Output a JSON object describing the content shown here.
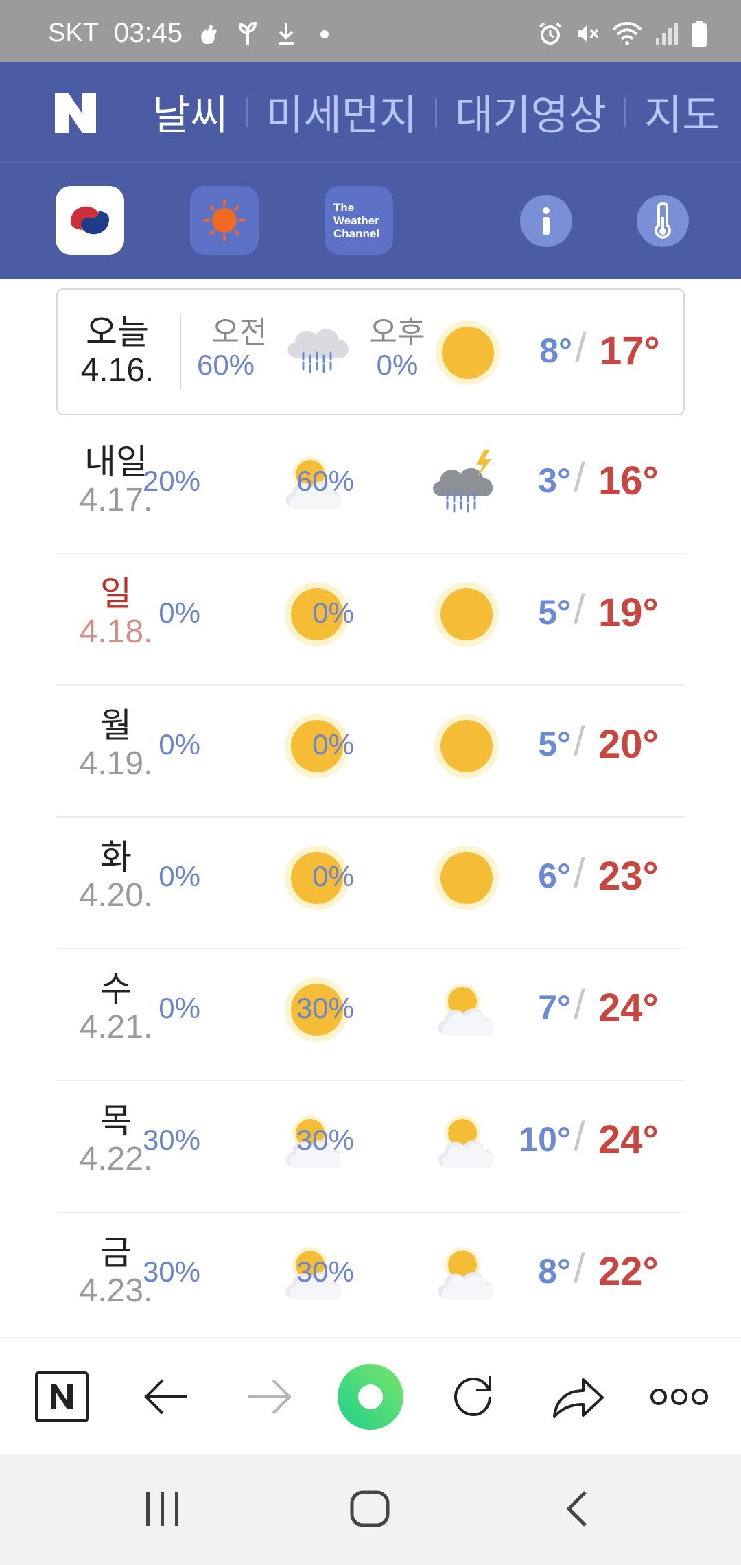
{
  "status_bar": {
    "carrier": "SKT",
    "time": "03:45",
    "left_icons": [
      "hand-icon",
      "sprout-icon",
      "download-icon",
      "dot-icon"
    ],
    "right_icons": [
      "alarm-icon",
      "mute-icon",
      "wifi-icon",
      "signal-icon",
      "battery-icon"
    ]
  },
  "nav": {
    "logo": "N",
    "tabs": [
      {
        "label": "날씨",
        "active": true
      },
      {
        "label": "미세먼지",
        "active": false
      },
      {
        "label": "대기영상",
        "active": false
      },
      {
        "label": "지도",
        "active": false
      }
    ]
  },
  "providers": {
    "items": [
      {
        "name": "korea-meteorological-icon",
        "selected": true
      },
      {
        "name": "sun-provider-icon",
        "selected": false
      },
      {
        "name": "the-weather-channel-logo",
        "selected": false,
        "text": "The Weather Channel"
      }
    ],
    "info_icon": "info-icon",
    "thermometer_icon": "thermometer-icon"
  },
  "forecast": {
    "am_label": "오전",
    "pm_label": "오후",
    "days": [
      {
        "name": "오늘",
        "date": "4.16.",
        "am_pct": "60%",
        "am_icon": "rain",
        "pm_pct": "0%",
        "pm_icon": "sunny",
        "low": "8°",
        "high": "17°",
        "today": true,
        "sunday": false
      },
      {
        "name": "내일",
        "date": "4.17.",
        "am_pct": "20%",
        "am_icon": "partly-cloudy",
        "pm_pct": "60%",
        "pm_icon": "thunder-rain",
        "low": "3°",
        "high": "16°",
        "today": false,
        "sunday": false
      },
      {
        "name": "일",
        "date": "4.18.",
        "am_pct": "0%",
        "am_icon": "sunny",
        "pm_pct": "0%",
        "pm_icon": "sunny",
        "low": "5°",
        "high": "19°",
        "today": false,
        "sunday": true
      },
      {
        "name": "월",
        "date": "4.19.",
        "am_pct": "0%",
        "am_icon": "sunny",
        "pm_pct": "0%",
        "pm_icon": "sunny",
        "low": "5°",
        "high": "20°",
        "today": false,
        "sunday": false
      },
      {
        "name": "화",
        "date": "4.20.",
        "am_pct": "0%",
        "am_icon": "sunny",
        "pm_pct": "0%",
        "pm_icon": "sunny",
        "low": "6°",
        "high": "23°",
        "today": false,
        "sunday": false
      },
      {
        "name": "수",
        "date": "4.21.",
        "am_pct": "0%",
        "am_icon": "sunny",
        "pm_pct": "30%",
        "pm_icon": "partly-cloudy",
        "low": "7°",
        "high": "24°",
        "today": false,
        "sunday": false
      },
      {
        "name": "목",
        "date": "4.22.",
        "am_pct": "30%",
        "am_icon": "partly-cloudy",
        "pm_pct": "30%",
        "pm_icon": "partly-cloudy",
        "low": "10°",
        "high": "24°",
        "today": false,
        "sunday": false
      },
      {
        "name": "금",
        "date": "4.23.",
        "am_pct": "30%",
        "am_icon": "partly-cloudy",
        "pm_pct": "30%",
        "pm_icon": "partly-cloudy",
        "low": "8°",
        "high": "22°",
        "today": false,
        "sunday": false
      }
    ],
    "slash": "/"
  },
  "browser_bar": {
    "items": [
      "naver-home-icon",
      "back-arrow-icon",
      "forward-arrow-icon",
      "green-dot-icon",
      "refresh-icon",
      "share-icon",
      "more-icon"
    ]
  },
  "android_nav": {
    "items": [
      "recents-icon",
      "home-icon",
      "back-icon"
    ]
  },
  "colors": {
    "nav_bg": "#4b5ca4",
    "accent_blue": "#6a84cf",
    "high_temp": "#c9453f",
    "sunday_red": "#b8322a",
    "sun_yellow": "#f5bd36"
  }
}
